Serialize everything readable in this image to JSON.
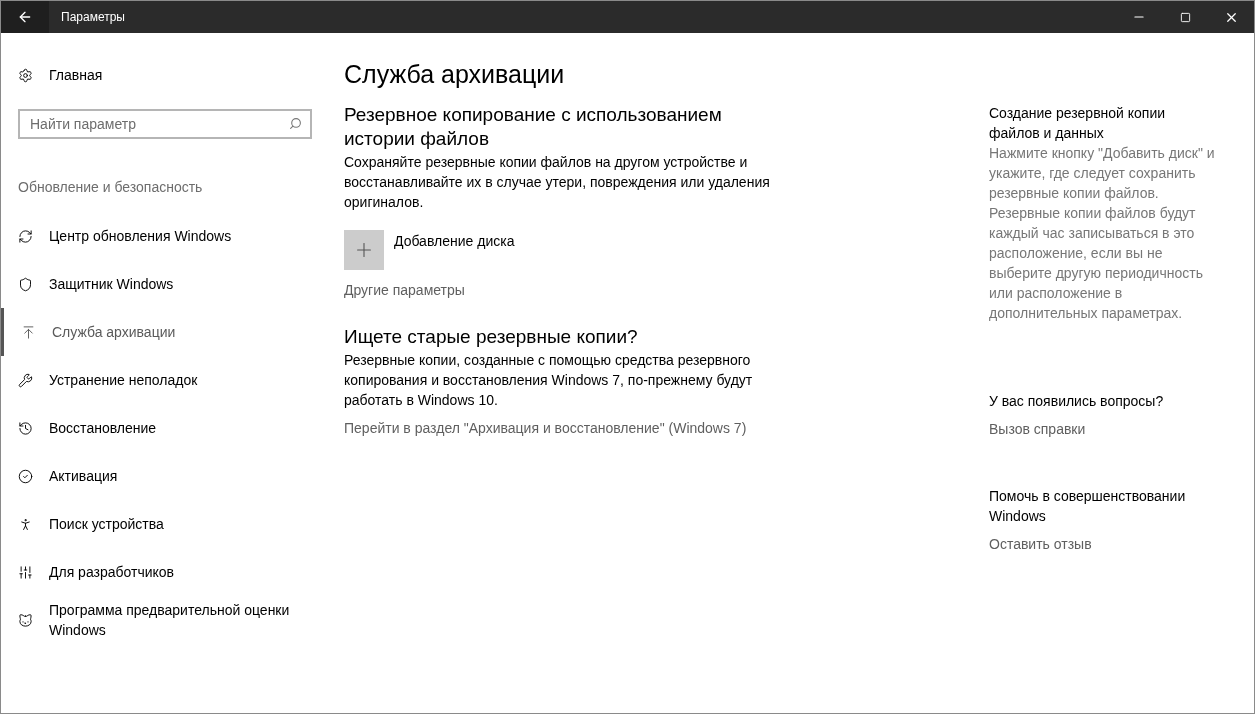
{
  "window": {
    "title": "Параметры"
  },
  "sidebar": {
    "home": "Главная",
    "search": {
      "placeholder": "Найти параметр"
    },
    "section": "Обновление и безопасность",
    "items": [
      {
        "label": "Центр обновления Windows",
        "selected": false
      },
      {
        "label": "Защитник Windows",
        "selected": false
      },
      {
        "label": "Служба архивации",
        "selected": true
      },
      {
        "label": "Устранение неполадок",
        "selected": false
      },
      {
        "label": "Восстановление",
        "selected": false
      },
      {
        "label": "Активация",
        "selected": false
      },
      {
        "label": "Поиск устройства",
        "selected": false
      },
      {
        "label": "Для разработчиков",
        "selected": false
      },
      {
        "label": "Программа предварительной оценки Windows",
        "selected": false
      }
    ]
  },
  "main": {
    "title": "Служба архивации",
    "sections": [
      {
        "heading": "Резервное копирование с использованием истории файлов",
        "text": "Сохраняйте резервные копии файлов на другом устройстве и восстанавливайте их в случае утери, повреждения или удаления оригиналов.",
        "add_button": "Добавление диска",
        "link": "Другие параметры"
      },
      {
        "heading": "Ищете старые резервные копии?",
        "text": "Резервные копии, созданные с помощью средства резервного копирования и восстановления Windows 7, по-прежнему будут работать в Windows 10.",
        "link": "Перейти в раздел \"Архивация и восстановление\" (Windows 7)"
      }
    ]
  },
  "aside": [
    {
      "heading": "Создание резервной копии файлов и данных",
      "text": "Нажмите кнопку \"Добавить диск\" и укажите, где следует сохранить резервные копии файлов. Резервные копии файлов будут каждый час записываться в это расположение, если вы не выберите другую периодичность или расположение в дополнительных параметрах."
    },
    {
      "heading": "У вас появились вопросы?",
      "link": "Вызов справки"
    },
    {
      "heading": "Помочь в совершенствовании Windows",
      "link": "Оставить отзыв"
    }
  ]
}
